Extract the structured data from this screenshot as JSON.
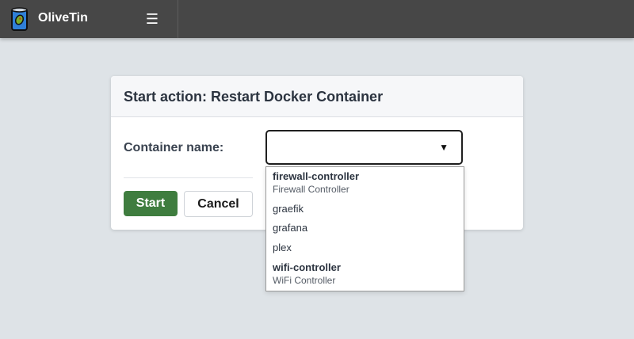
{
  "app": {
    "title": "OliveTin",
    "menu_icon": "☰"
  },
  "dialog": {
    "title": "Start action: Restart Docker Container",
    "field_label": "Container name:",
    "select_value": "",
    "select_arrow": "▼",
    "start_label": "Start",
    "cancel_label": "Cancel"
  },
  "dropdown": {
    "options": [
      {
        "name": "firewall-controller",
        "description": "Firewall Controller"
      },
      {
        "name": "graefik",
        "description": ""
      },
      {
        "name": "grafana",
        "description": ""
      },
      {
        "name": "plex",
        "description": ""
      },
      {
        "name": "wifi-controller",
        "description": "WiFi Controller"
      }
    ]
  },
  "colors": {
    "topbar": "#474747",
    "background": "#dee3e7",
    "start_button": "#3f7d3f",
    "logo_can": "#2f80d8"
  },
  "icons": {
    "logo": "olive-can-icon",
    "menu": "hamburger-menu-icon",
    "select_arrow": "dropdown-arrow-icon"
  }
}
